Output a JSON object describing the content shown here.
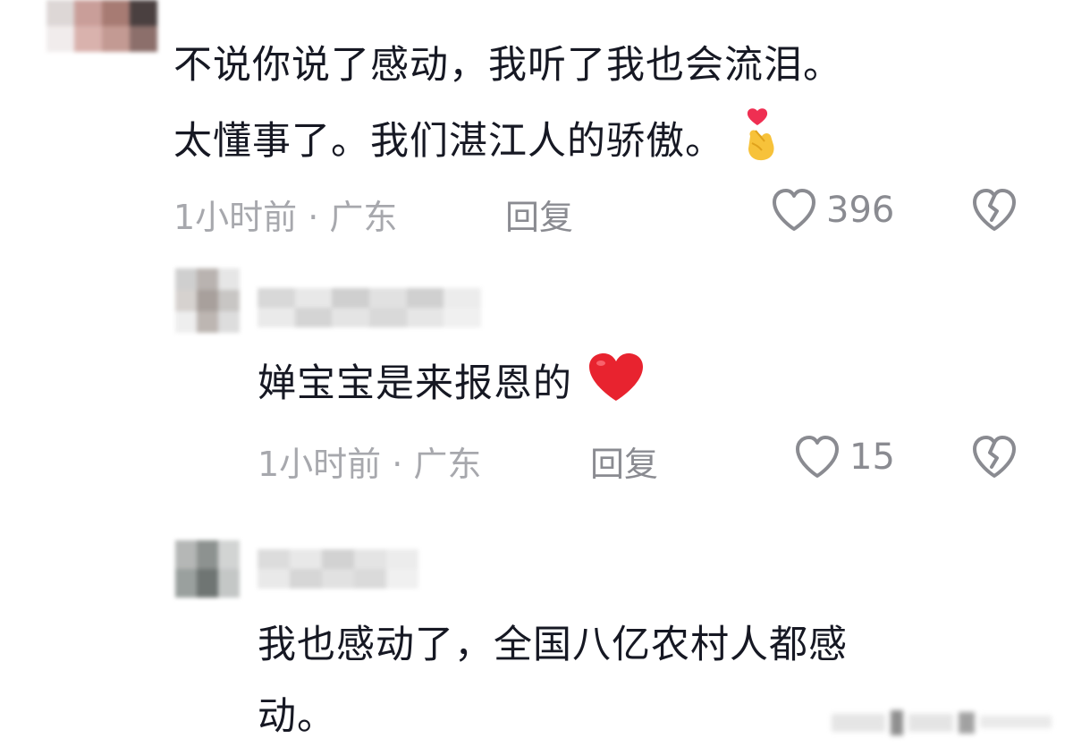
{
  "comments": [
    {
      "line1": "不说你说了感动，我听了我也会流泪。",
      "line2": "太懂事了。我们湛江人的骄傲。",
      "emoji": "finger-heart-emoji",
      "time_location": "1小时前 · 广东",
      "reply_label": "回复",
      "likes": "396"
    },
    {
      "text": "婵宝宝是来报恩的",
      "emoji": "red-heart-emoji",
      "time_location": "1小时前 · 广东",
      "reply_label": "回复",
      "likes": "15"
    },
    {
      "line1": "我也感动了，全国八亿农村人都感",
      "line2": "动。"
    }
  ],
  "colors": {
    "text": "#161823",
    "meta": "#a7a8ad",
    "action": "#8a8b91",
    "heart": "#e8232f"
  },
  "icons": {
    "like": "heart-outline-icon",
    "dislike": "broken-heart-outline-icon"
  }
}
